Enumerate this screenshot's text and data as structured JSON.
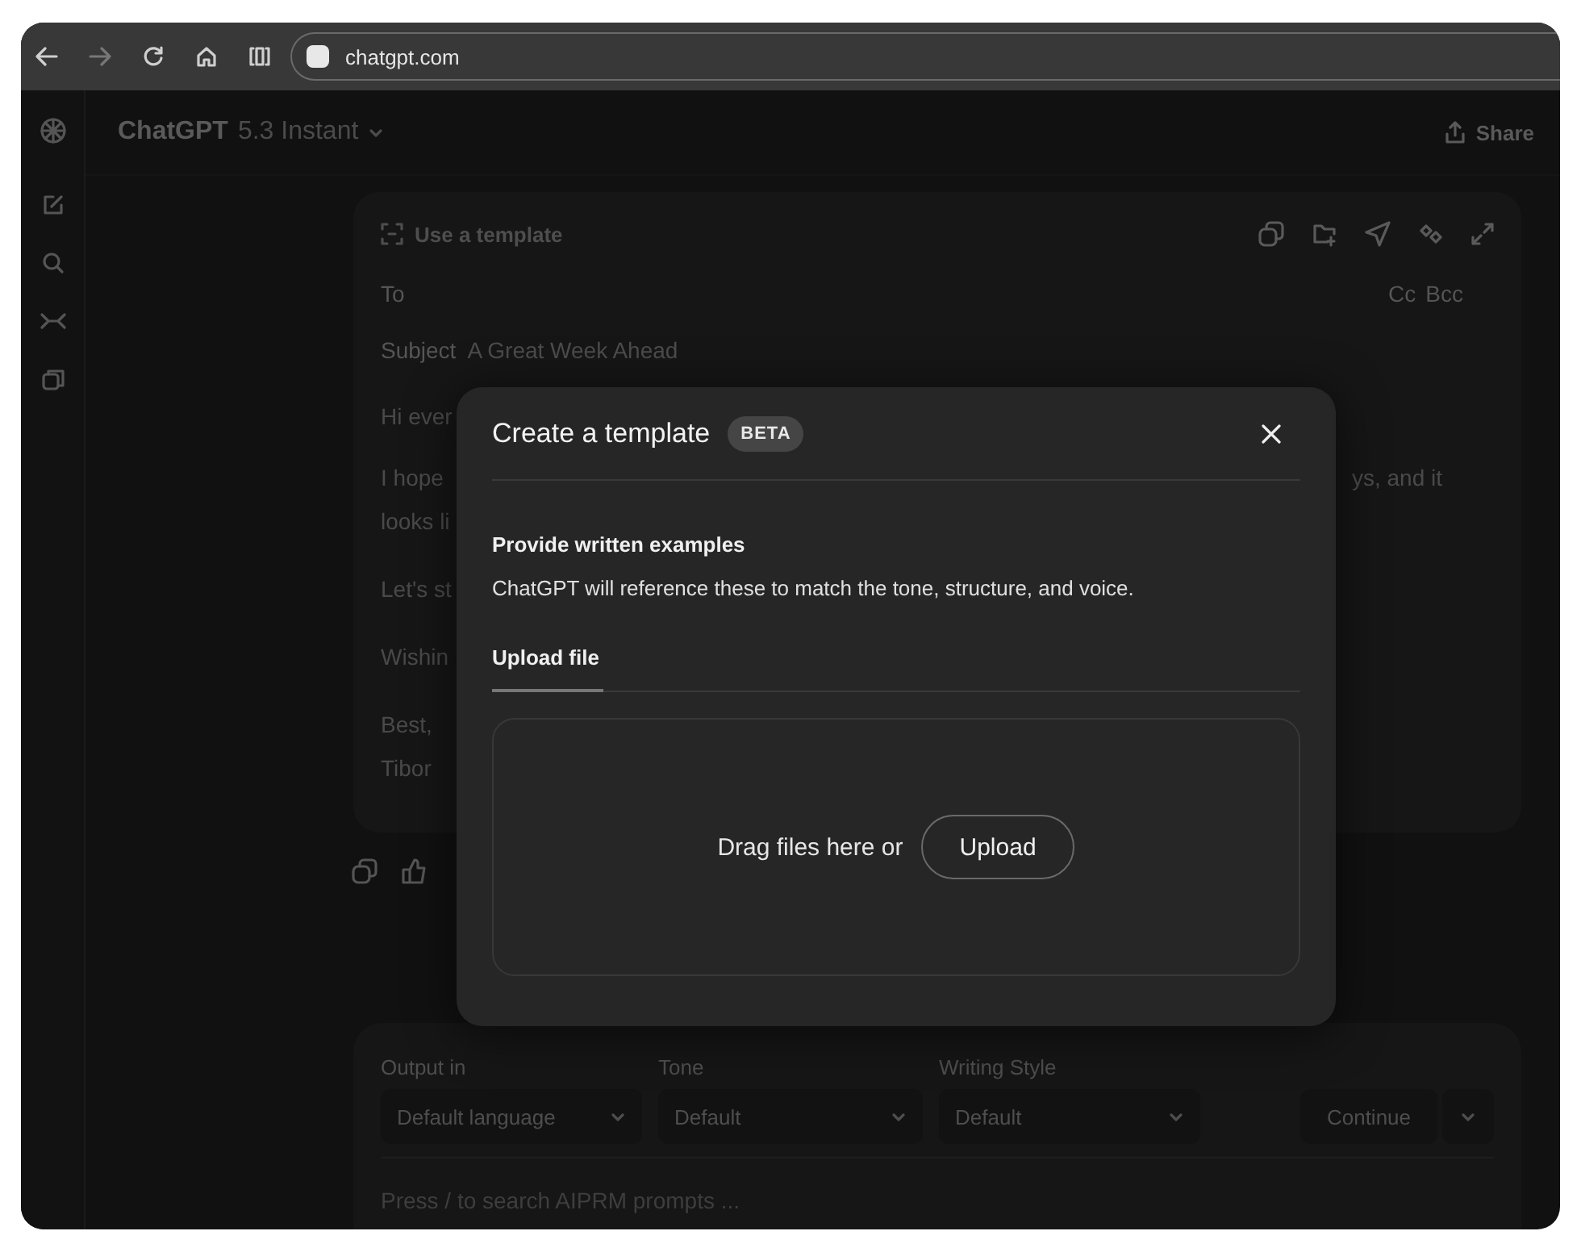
{
  "browser": {
    "url": "chatgpt.com"
  },
  "header": {
    "title": "ChatGPT",
    "model": "5.3 Instant",
    "share": "Share"
  },
  "email": {
    "template_link": "Use a template",
    "to_label": "To",
    "cc": "Cc",
    "bcc": "Bcc",
    "subject_label": "Subject",
    "subject": "A Great Week Ahead",
    "paragraphs": [
      [
        {
          "text": "Hi ever"
        }
      ],
      [
        {
          "text": "I hope",
          "tail": "ys, and it"
        },
        {
          "text": "looks li"
        }
      ],
      [
        {
          "text": "Let's st"
        }
      ],
      [
        {
          "text": "Wishin"
        }
      ],
      [
        {
          "text": "Best,"
        },
        {
          "text": "Tibor"
        }
      ]
    ]
  },
  "modal": {
    "title": "Create a template",
    "badge": "BETA",
    "section_title": "Provide written examples",
    "description": "ChatGPT will reference these to match the tone, structure, and voice.",
    "tabs": [
      {
        "label": "Upload file",
        "selected": true
      }
    ],
    "dropzone_text": "Drag files here or",
    "upload_button": "Upload"
  },
  "composer": {
    "selects": [
      {
        "label": "Output in",
        "value": "Default language"
      },
      {
        "label": "Tone",
        "value": "Default"
      },
      {
        "label": "Writing Style",
        "value": "Default"
      }
    ],
    "continue_button": "Continue",
    "placeholder": "Press / to search AIPRM prompts ..."
  }
}
